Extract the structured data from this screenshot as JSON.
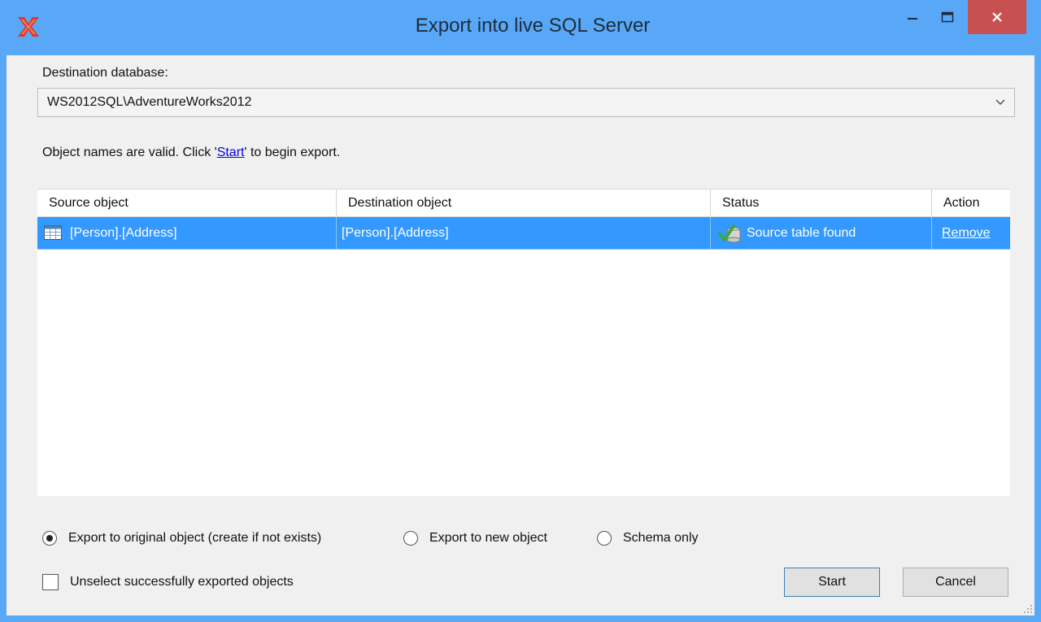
{
  "window": {
    "title": "Export into live SQL Server",
    "minimize_glyph": "–",
    "close_glyph": "✕"
  },
  "destination": {
    "label": "Destination database:",
    "value": "WS2012SQL\\AdventureWorks2012"
  },
  "info": {
    "prefix": "Object names are valid. Click '",
    "link": "Start",
    "suffix": "' to begin export."
  },
  "grid": {
    "columns": [
      "Source object",
      "Destination object",
      "Status",
      "Action"
    ],
    "rows": [
      {
        "source": "[Person].[Address]",
        "destination": "[Person].[Address]",
        "status": "Source table found",
        "action": "Remove",
        "source_icon": "table-icon",
        "status_icon": "check-database-icon"
      }
    ]
  },
  "options": {
    "radio": [
      {
        "label": "Export to original object (create if not exists)",
        "checked": true
      },
      {
        "label": "Export to new object",
        "checked": false
      },
      {
        "label": "Schema only",
        "checked": false
      }
    ],
    "checkbox_label": "Unselect successfully exported objects",
    "checkbox_checked": false
  },
  "buttons": {
    "start": "Start",
    "cancel": "Cancel"
  },
  "colors": {
    "titlebar": "#58a8f7",
    "close_button": "#c75050",
    "selection": "#3399ff"
  }
}
